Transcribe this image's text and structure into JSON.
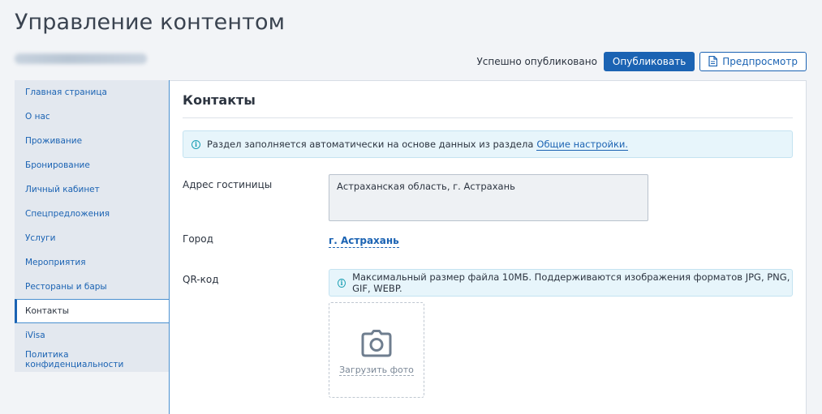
{
  "header": {
    "title": "Управление контентом",
    "publish_status": "Успешно опубликовано",
    "publish_label": "Опубликовать",
    "preview_label": "Предпросмотр"
  },
  "sidebar": {
    "items": [
      {
        "label": "Главная страница"
      },
      {
        "label": "О нас"
      },
      {
        "label": "Проживание"
      },
      {
        "label": "Бронирование"
      },
      {
        "label": "Личный кабинет"
      },
      {
        "label": "Спецпредложения"
      },
      {
        "label": "Услуги"
      },
      {
        "label": "Мероприятия"
      },
      {
        "label": "Рестораны и бары"
      },
      {
        "label": "Контакты"
      },
      {
        "label": "iVisa"
      },
      {
        "label": "Политика конфиденциальности"
      }
    ],
    "active_index": 9
  },
  "main": {
    "section_title": "Контакты",
    "info_text": "Раздел заполняется автоматически на основе данных из раздела",
    "info_link": "Общие настройки.",
    "address_label": "Адрес гостиницы",
    "address_value": "Астраханская область, г. Астрахань",
    "city_label": "Город",
    "city_value": "г. Астрахань",
    "qr_label": "QR-код",
    "qr_info": "Максимальный размер файла 10МБ. Поддерживаются изображения форматов JPG, PNG, GIF, WEBP.",
    "upload_label": "Загрузить фото"
  },
  "icons": {
    "info": "info-circle-icon",
    "preview": "document-icon",
    "upload": "camera-icon"
  },
  "colors": {
    "accent": "#1b63b3",
    "info_bg": "#e7f5fb",
    "sidebar_bg": "#e3e8ef"
  }
}
